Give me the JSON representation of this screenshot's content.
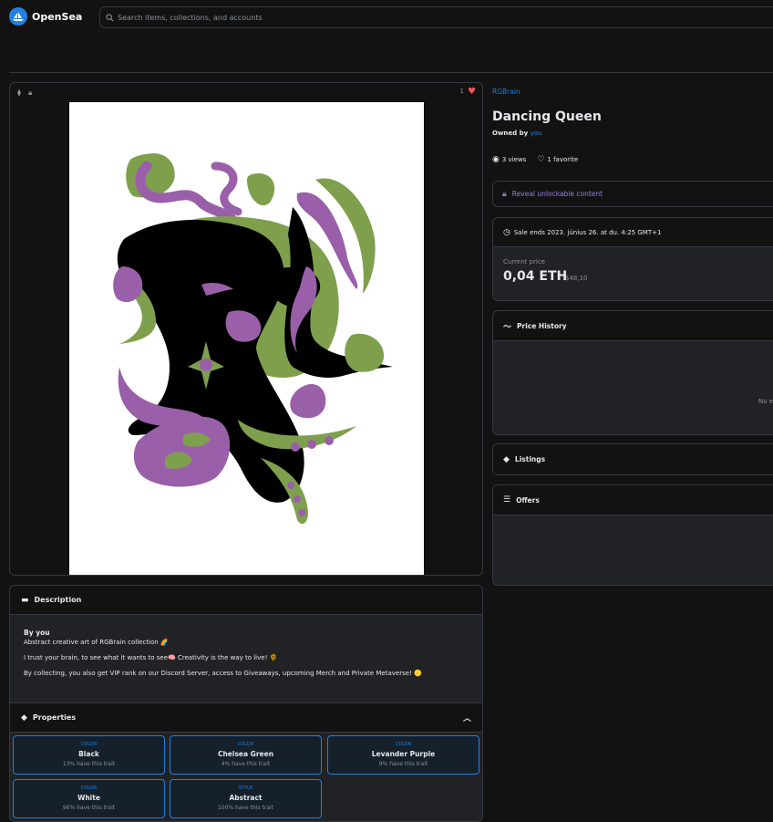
{
  "header": {
    "logo_text": "OpenSea",
    "search_placeholder": "Search items, collections, and accounts"
  },
  "media": {
    "favorite_count": "1"
  },
  "description": {
    "heading": "Description",
    "by_label": "By",
    "by_user": "you",
    "lines": [
      "Abstract creative art of RGBrain collection 🌈",
      "I trust your brain, to see what it wants to see🧠 Creativity is the way to live! 🌻",
      "By collecting, you also get VIP rank on our Discord Server, access to Giveaways, upcoming Merch and Private Metaverse! 🟡"
    ]
  },
  "properties": {
    "heading": "Properties",
    "items": [
      {
        "type": "COLOR",
        "value": "Black",
        "rarity": "13% have this trait"
      },
      {
        "type": "COLOR",
        "value": "Chelsea Green",
        "rarity": "4% have this trait"
      },
      {
        "type": "COLOR",
        "value": "Levander Purple",
        "rarity": "9% have this trait"
      },
      {
        "type": "COLOR",
        "value": "White",
        "rarity": "96% have this trait"
      },
      {
        "type": "STYLE",
        "value": "Abstract",
        "rarity": "100% have this trait"
      }
    ]
  },
  "item": {
    "collection": "RGBrain",
    "title": "Dancing Queen",
    "owned_by_label": "Owned by",
    "owner": "you",
    "views": "3 views",
    "favorites": "1 favorite"
  },
  "unlockable": {
    "label": "Reveal unlockable content"
  },
  "sale": {
    "ends": "Sale ends 2023. június 26. at du. 4:25 GMT+1",
    "current_price_label": "Current price",
    "price": "0,04 ETH",
    "usd": "$48,10"
  },
  "price_history": {
    "heading": "Price History",
    "empty": "No e"
  },
  "listings": {
    "heading": "Listings"
  },
  "offers": {
    "heading": "Offers"
  },
  "colors": {
    "accent": "#2081e2",
    "purple": "#9a5fa9",
    "green": "#7ea04d",
    "black": "#000000"
  }
}
